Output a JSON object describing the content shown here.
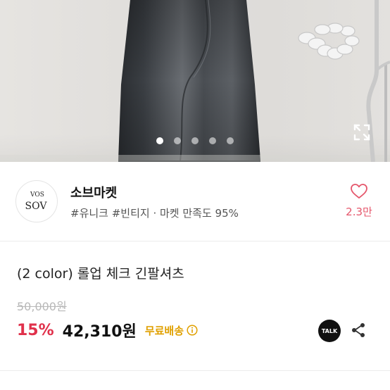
{
  "carousel": {
    "slide_count": 5,
    "active_index": 0
  },
  "shop": {
    "name": "소브마켓",
    "meta": "#유니크 #빈티지 · 마켓 만족도 95%",
    "like_count": "2.3만",
    "avatar": {
      "line1": "VOS",
      "line2": "SOV"
    }
  },
  "product": {
    "title": "(2 color) 롤업 체크 긴팔셔츠",
    "original_price": "50,000원",
    "discount": "15%",
    "price": "42,310원",
    "shipping": "무료배송"
  },
  "actions": {
    "talk_label": "TALK"
  },
  "icons": {
    "expand": "expand-icon",
    "heart": "heart-icon",
    "info": "info-icon",
    "talk": "kakaotalk-icon",
    "share": "share-icon"
  },
  "colors": {
    "accent_red": "#e0314b",
    "like_pink": "#e5566b",
    "shipping_yellow": "#e0a000"
  }
}
